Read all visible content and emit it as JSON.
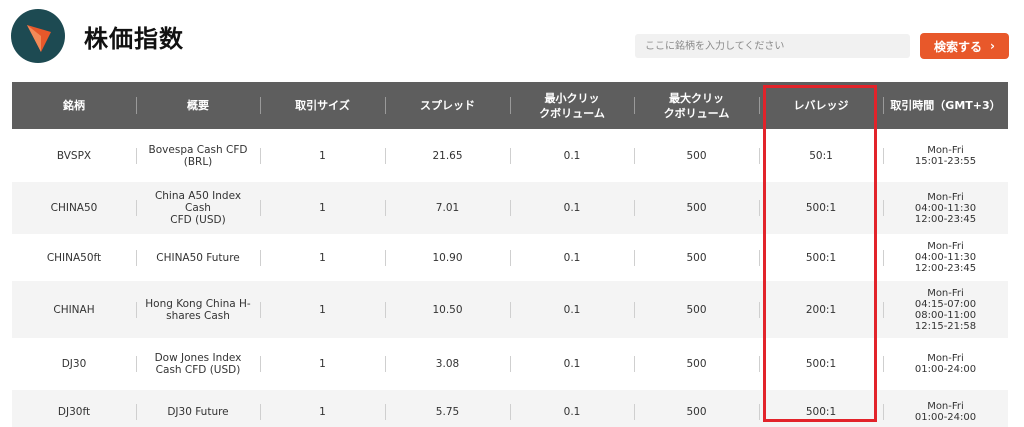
{
  "header": {
    "title": "株価指数",
    "search_placeholder": "ここに銘柄を入力してください",
    "search_button": "検索する"
  },
  "colors": {
    "logo_bg": "#1d4a52",
    "accent": "#e8582a",
    "table_header": "#5e5e5e",
    "highlight": "#e2232a"
  },
  "table": {
    "columns": [
      "銘柄",
      "概要",
      "取引サイズ",
      "スプレッド",
      "最小クリックボリューム",
      "最大クリックボリューム",
      "レバレッジ",
      "取引時間（GMT+3）"
    ],
    "column_lines": [
      [
        "銘柄"
      ],
      [
        "概要"
      ],
      [
        "取引サイズ"
      ],
      [
        "スプレッド"
      ],
      [
        "最小クリッ",
        "クボリューム"
      ],
      [
        "最大クリッ",
        "クボリューム"
      ],
      [
        "レバレッジ"
      ],
      [
        "取引時間（GMT+3）"
      ]
    ],
    "rows": [
      {
        "symbol": "BVSPX",
        "desc": [
          "Bovespa Cash CFD",
          "(BRL)"
        ],
        "size": "1",
        "spread": "21.65",
        "min": "0.1",
        "max": "500",
        "leverage": "50:1",
        "hours": [
          "Mon-Fri",
          "15:01-23:55"
        ]
      },
      {
        "symbol": "CHINA50",
        "desc": [
          "China A50 Index Cash",
          "CFD (USD)"
        ],
        "size": "1",
        "spread": "7.01",
        "min": "0.1",
        "max": "500",
        "leverage": "500:1",
        "hours": [
          "Mon-Fri",
          "04:00-11:30",
          "12:00-23:45"
        ]
      },
      {
        "symbol": "CHINA50ft",
        "desc": [
          "CHINA50 Future"
        ],
        "size": "1",
        "spread": "10.90",
        "min": "0.1",
        "max": "500",
        "leverage": "500:1",
        "hours": [
          "Mon-Fri",
          "04:00-11:30",
          "12:00-23:45"
        ]
      },
      {
        "symbol": "CHINAH",
        "desc": [
          "Hong Kong China H-",
          "shares Cash"
        ],
        "size": "1",
        "spread": "10.50",
        "min": "0.1",
        "max": "500",
        "leverage": "200:1",
        "hours": [
          "Mon-Fri",
          "04:15-07:00",
          "08:00-11:00",
          "12:15-21:58"
        ]
      },
      {
        "symbol": "DJ30",
        "desc": [
          "Dow Jones Index",
          "Cash CFD (USD)"
        ],
        "size": "1",
        "spread": "3.08",
        "min": "0.1",
        "max": "500",
        "leverage": "500:1",
        "hours": [
          "Mon-Fri",
          "01:00-24:00"
        ]
      },
      {
        "symbol": "DJ30ft",
        "desc": [
          "DJ30 Future"
        ],
        "size": "1",
        "spread": "5.75",
        "min": "0.1",
        "max": "500",
        "leverage": "500:1",
        "hours": [
          "Mon-Fri",
          "01:00-24:00"
        ]
      }
    ]
  }
}
